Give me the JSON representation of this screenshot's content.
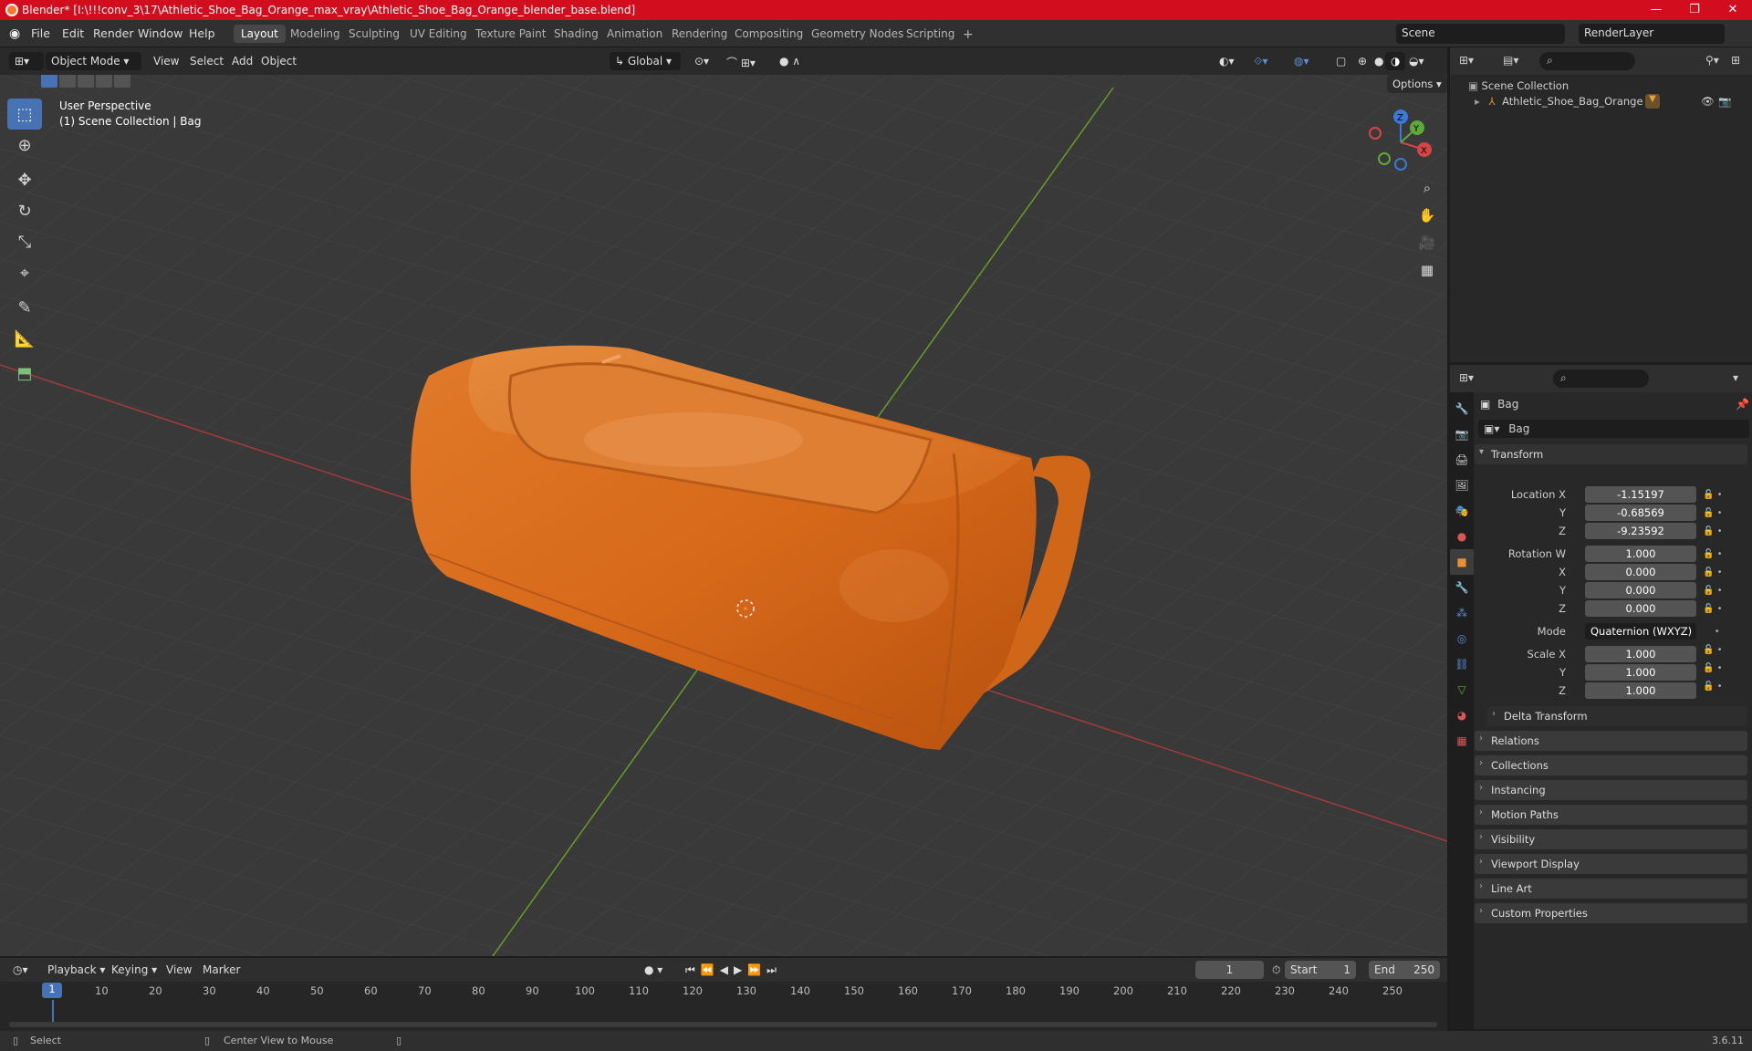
{
  "titlebar": {
    "title": "Blender* [I:\\!!!conv_3\\17\\Athletic_Shoe_Bag_Orange_max_vray\\Athletic_Shoe_Bag_Orange_blender_base.blend]",
    "minimize": "—",
    "maximize": "❐",
    "close": "✕"
  },
  "menu": {
    "file": "File",
    "edit": "Edit",
    "render": "Render",
    "window": "Window",
    "help": "Help"
  },
  "workspaces": [
    "Layout",
    "Modeling",
    "Sculpting",
    "UV Editing",
    "Texture Paint",
    "Shading",
    "Animation",
    "Rendering",
    "Compositing",
    "Geometry Nodes",
    "Scripting"
  ],
  "add_workspace": "+",
  "scene": {
    "name": "Scene",
    "render_layer": "RenderLayer"
  },
  "viewport_header": {
    "mode": "Object Mode",
    "view": "View",
    "select": "Select",
    "add": "Add",
    "object": "Object",
    "transform_orientation": "Global",
    "options": "Options"
  },
  "viewport": {
    "perspective": "User Perspective",
    "collection_info": "(1) Scene Collection | Bag"
  },
  "gizmo": {
    "x": "X",
    "y": "Y",
    "z": "Z"
  },
  "outliner": {
    "root": "Scene Collection",
    "items": [
      {
        "label": "Athletic_Shoe_Bag_Orange"
      }
    ]
  },
  "properties": {
    "object_name": "Bag",
    "data_name": "Bag",
    "transform_title": "Transform",
    "location_label": "Location X",
    "location": {
      "x": "-1.15197",
      "y": "-0.68569",
      "z": "-9.23592"
    },
    "rotation_label": "Rotation W",
    "rotation": {
      "w": "1.000",
      "x": "0.000",
      "y": "0.000",
      "z": "0.000"
    },
    "axis_y": "Y",
    "axis_z": "Z",
    "axis_x": "X",
    "mode_label": "Mode",
    "mode_value": "Quaternion (WXYZ)",
    "scale_label": "Scale X",
    "scale": {
      "x": "1.000",
      "y": "1.000",
      "z": "1.000"
    },
    "delta_transform": "Delta Transform",
    "sections": [
      "Relations",
      "Collections",
      "Instancing",
      "Motion Paths",
      "Visibility",
      "Viewport Display",
      "Line Art",
      "Custom Properties"
    ]
  },
  "timeline": {
    "playback": "Playback",
    "keying": "Keying",
    "view": "View",
    "marker": "Marker",
    "current_frame": "1",
    "start_label": "Start",
    "start": "1",
    "end_label": "End",
    "end": "250",
    "ticks": [
      "10",
      "20",
      "30",
      "40",
      "50",
      "60",
      "70",
      "80",
      "90",
      "100",
      "110",
      "120",
      "130",
      "140",
      "150",
      "160",
      "170",
      "180",
      "190",
      "200",
      "210",
      "220",
      "230",
      "240",
      "250"
    ],
    "playhead": "1"
  },
  "status": {
    "select": "Select",
    "center_view": "Center View to Mouse",
    "version": "3.6.11"
  }
}
